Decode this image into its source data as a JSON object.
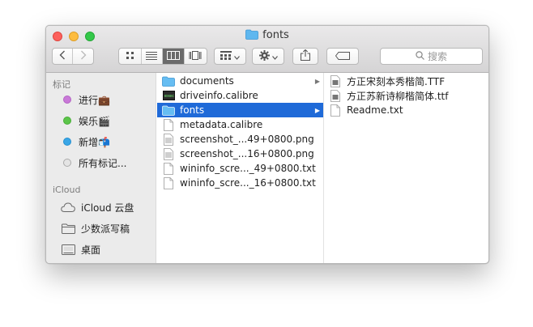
{
  "window": {
    "title": "fonts"
  },
  "toolbar": {
    "back_icon": "chevron-left",
    "forward_icon": "chevron-right",
    "views": [
      "icon-view",
      "list-view",
      "column-view",
      "cover-flow-view"
    ],
    "active_view": "column-view",
    "search_placeholder": "搜索"
  },
  "sidebar": {
    "tags_header": "标记",
    "tags": [
      {
        "label": "进行💼",
        "color": "#c979d8"
      },
      {
        "label": "娱乐🎬",
        "color": "#5cc54a"
      },
      {
        "label": "新增📬",
        "color": "#3aa6e6"
      },
      {
        "label": "所有标记...",
        "color": "#c8c8c8"
      }
    ],
    "icloud_header": "iCloud",
    "icloud": [
      {
        "label": "iCloud 云盘",
        "icon": "cloud-icon"
      },
      {
        "label": "少数派写稿",
        "icon": "folder-icon"
      },
      {
        "label": "桌面",
        "icon": "desktop-folder-icon"
      }
    ]
  },
  "column1": [
    {
      "name": "documents",
      "type": "folder"
    },
    {
      "name": "driveinfo.calibre",
      "type": "exec"
    },
    {
      "name": "fonts",
      "type": "folder",
      "selected": true
    },
    {
      "name": "metadata.calibre",
      "type": "doc"
    },
    {
      "name": "screenshot_...49+0800.png",
      "type": "doc"
    },
    {
      "name": "screenshot_...16+0800.png",
      "type": "doc"
    },
    {
      "name": "wininfo_scre..._49+0800.txt",
      "type": "doc"
    },
    {
      "name": "wininfo_scre..._16+0800.txt",
      "type": "doc"
    }
  ],
  "column2": [
    {
      "name": "方正宋刻本秀楷简.TTF",
      "type": "font"
    },
    {
      "name": "方正苏新诗柳楷简体.ttf",
      "type": "font"
    },
    {
      "name": "Readme.txt",
      "type": "doc"
    }
  ]
}
